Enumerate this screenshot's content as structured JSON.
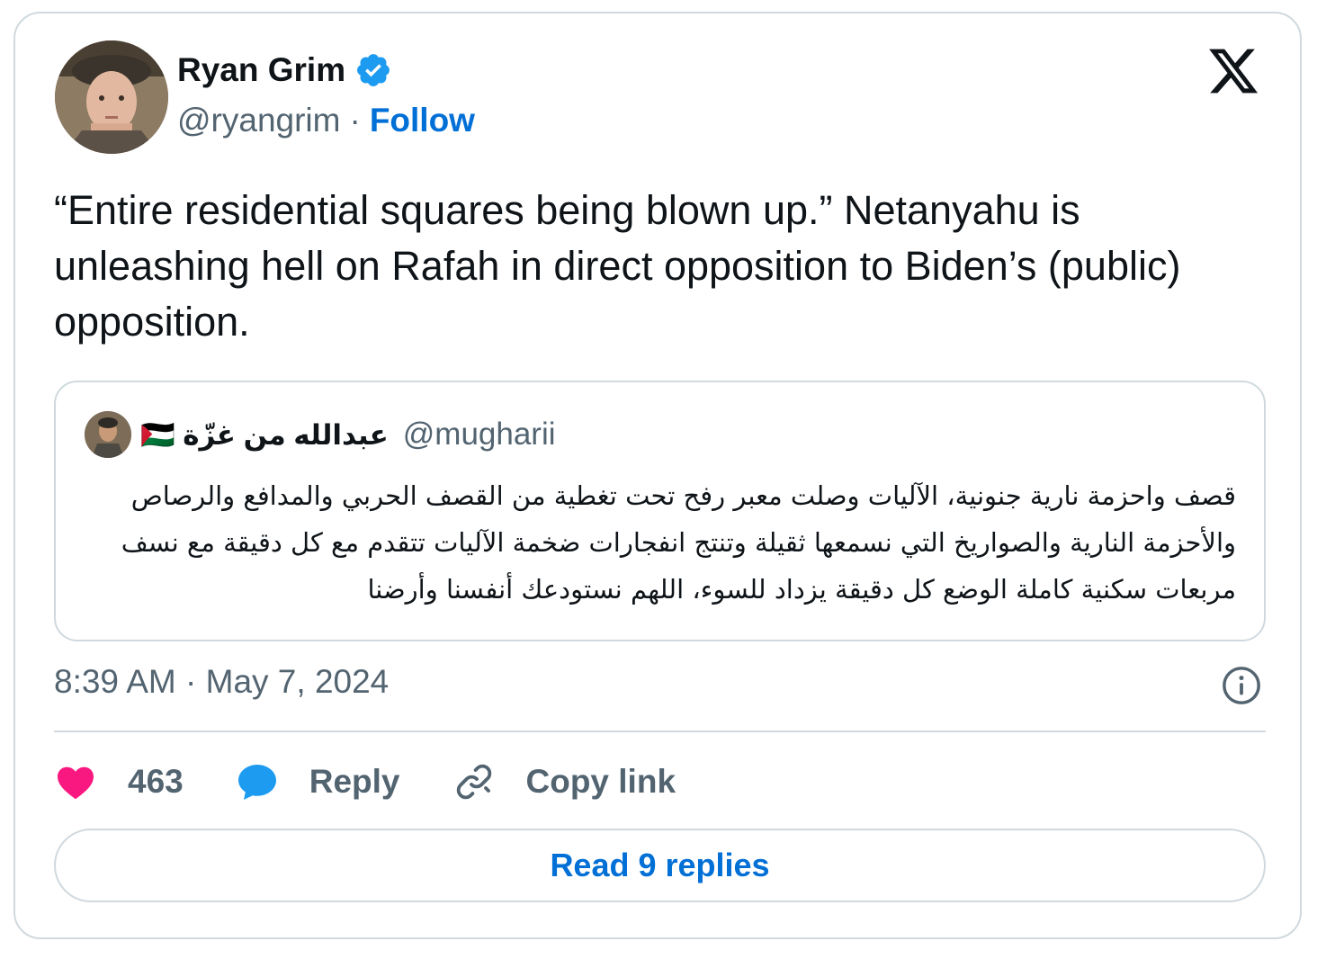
{
  "author": {
    "name": "Ryan Grim",
    "handle": "@ryangrim",
    "separator": "·",
    "follow_label": "Follow",
    "verified_color": "#1d9bf0"
  },
  "tweet": {
    "text": "“Entire residential squares being blown up.” Netanyahu is unleashing hell on Rafah in direct opposition to Biden’s (public) opposition.",
    "timestamp": "8:39 AM · May 7, 2024"
  },
  "quoted": {
    "name": "عبدالله من غزّة 🇵🇸",
    "handle": "@mugharii",
    "text": "قصف واحزمة نارية جنونية، الآليات وصلت معبر رفح تحت تغطية من القصف الحربي والمدافع والرصاص والأحزمة النارية والصواريخ التي نسمعها ثقيلة وتنتج انفجارات ضخمة الآليات تتقدم مع كل دقيقة مع نسف مربعات سكنية كاملة الوضع كل دقيقة يزداد للسوء، اللهم نستودعك أنفسنا وأرضنا"
  },
  "actions": {
    "like_count": "463",
    "reply_label": "Reply",
    "copy_link_label": "Copy link",
    "read_replies_label": "Read 9 replies"
  },
  "icons": {
    "logo": "x-logo-icon",
    "verified": "verified-badge-icon",
    "like": "heart-icon",
    "reply": "speech-bubble-icon",
    "copy": "link-icon",
    "info": "info-icon"
  },
  "colors": {
    "like": "#f91880",
    "reply": "#1d9bf0",
    "link": "#006fd6",
    "secondary_text": "#536471",
    "border": "#cfd9de"
  }
}
